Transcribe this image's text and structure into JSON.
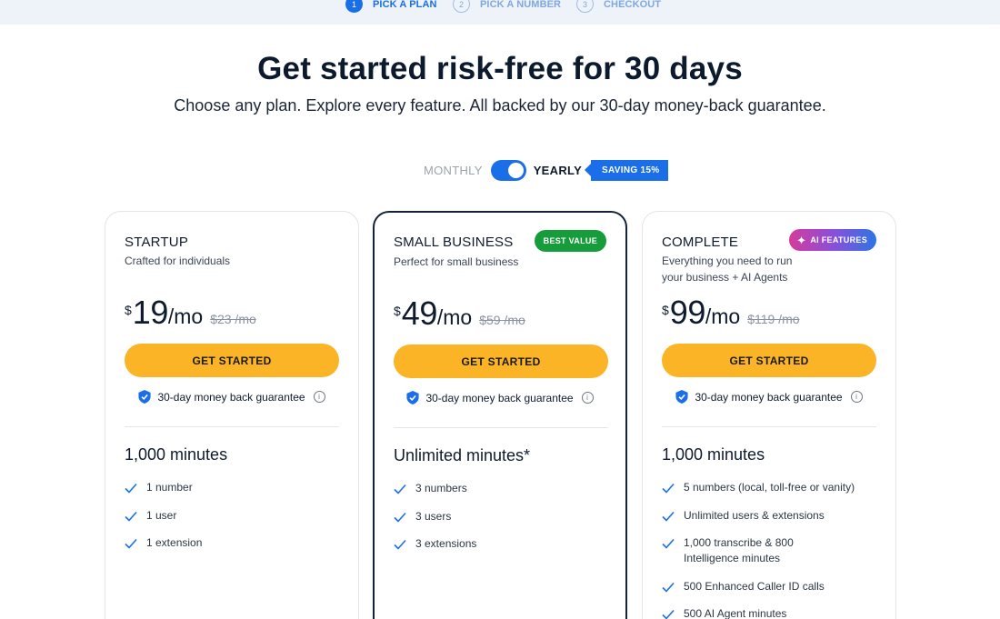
{
  "stepper": {
    "steps": [
      {
        "num": "1",
        "label": "PICK A PLAN"
      },
      {
        "num": "2",
        "label": "PICK A NUMBER"
      },
      {
        "num": "3",
        "label": "CHECKOUT"
      }
    ],
    "active_index": 0
  },
  "header": {
    "title": "Get started risk-free for 30 days",
    "subtitle": "Choose any plan. Explore every feature. All backed by our 30-day money-back guarantee."
  },
  "billing": {
    "monthly_label": "MONTHLY",
    "yearly_label": "YEARLY",
    "selected": "yearly",
    "saving_label": "SAVING 15%"
  },
  "plans": [
    {
      "name": "STARTUP",
      "description": "Crafted for individuals",
      "currency": "$",
      "price": "19",
      "per": "/mo",
      "old_price": "$23 /mo",
      "cta": "GET STARTED",
      "guarantee": "30-day money back guarantee",
      "minutes": "1,000 minutes",
      "features": [
        "1 number",
        "1 user",
        "1 extension"
      ]
    },
    {
      "name": "SMALL BUSINESS",
      "description": "Perfect for small business",
      "badge": "BEST VALUE",
      "currency": "$",
      "price": "49",
      "per": "/mo",
      "old_price": "$59 /mo",
      "cta": "GET STARTED",
      "guarantee": "30-day money back guarantee",
      "minutes": "Unlimited minutes*",
      "features": [
        "3 numbers",
        "3 users",
        "3 extensions"
      ]
    },
    {
      "name": "COMPLETE",
      "description": "Everything you need to run your business + AI Agents",
      "badge": "AI FEATURES",
      "currency": "$",
      "price": "99",
      "per": "/mo",
      "old_price": "$119 /mo",
      "cta": "GET STARTED",
      "guarantee": "30-day money back guarantee",
      "minutes": "1,000 minutes",
      "features": [
        "5 numbers (local, toll-free or vanity)",
        "Unlimited users & extensions",
        "1,000 transcribe & 800 Intelligence minutes",
        "500 Enhanced Caller ID calls",
        "500 AI Agent minutes"
      ]
    }
  ],
  "icons": {
    "guarantee": "shield-check-icon",
    "info": "info-icon",
    "feature": "check-icon",
    "ai": "sparkle-icon"
  },
  "colors": {
    "accent": "#1a6fe8",
    "cta": "#fbb426",
    "best_value": "#169c3b",
    "heading": "#0c1a2e"
  }
}
